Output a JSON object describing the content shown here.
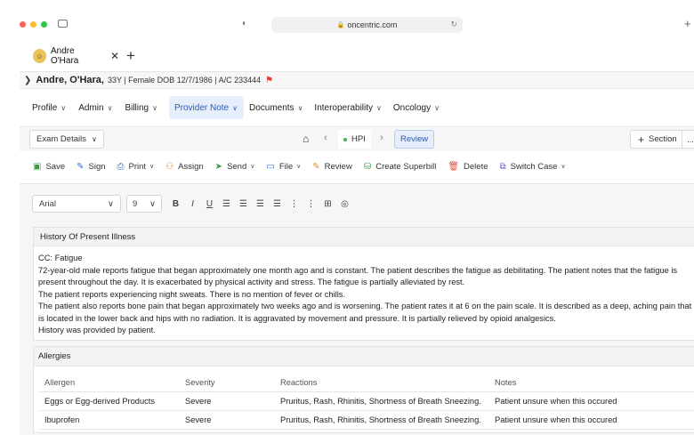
{
  "browser": {
    "url": "oncentric.com",
    "tab_title": "Andre O'Hara",
    "new_tab_label": "+"
  },
  "patient": {
    "name": "Andre, O'Hara,",
    "details": "33Y | Female DOB 12/7/1986 | A/C 233444"
  },
  "menu": {
    "items": [
      {
        "label": "Profile"
      },
      {
        "label": "Admin"
      },
      {
        "label": "Billing"
      },
      {
        "label": "Provider Note",
        "active": true
      },
      {
        "label": "Documents"
      },
      {
        "label": "Interoperability"
      },
      {
        "label": "Oncology"
      }
    ]
  },
  "toolbar": {
    "exam_details": "Exam Details",
    "hpi": "HPI",
    "review": "Review",
    "section": "Section",
    "more": "..."
  },
  "actions": {
    "save": "Save",
    "sign": "Sign",
    "print": "Print",
    "assign": "Assign",
    "send": "Send",
    "file": "File",
    "review": "Review",
    "create_superbill": "Create Superbill",
    "delete": "Delete",
    "switch_case": "Switch Case"
  },
  "editor": {
    "font": "Arial",
    "size": "9"
  },
  "hpi": {
    "title": "History Of Present Illness",
    "lines": [
      "CC: Fatigue",
      "72-year-old male reports fatigue that began approximately one month ago and is constant. The patient describes the fatigue as debilitating. The patient notes that the fatigue is present throughout the day. It is exacerbated by physical activity and stress. The fatigue is partially alleviated by rest.",
      "The patient reports experiencing night sweats. There is no mention of fever or chills.",
      "The patient also reports bone pain that began approximately two weeks ago and is worsening. The patient rates it at 6 on the pain scale. It is described as a deep, aching pain that is located in the lower back and hips with no radiation. It is aggravated by movement and pressure. It is partially relieved by opioid analgesics.",
      "History was provided by patient."
    ]
  },
  "allergies": {
    "title": "Allergies",
    "columns": [
      "Allergen",
      "Severity",
      "Reactions",
      "Notes"
    ],
    "rows": [
      [
        "Eggs or Egg-derived Products",
        "Severe",
        "Pruritus, Rash, Rhinitis, Shortness of Breath Sneezing.",
        "Patient unsure when this occured"
      ],
      [
        "Ibuprofen",
        "Severe",
        "Pruritus, Rash, Rhinitis, Shortness of Breath Sneezing.",
        "Patient unsure when this occured"
      ]
    ]
  }
}
